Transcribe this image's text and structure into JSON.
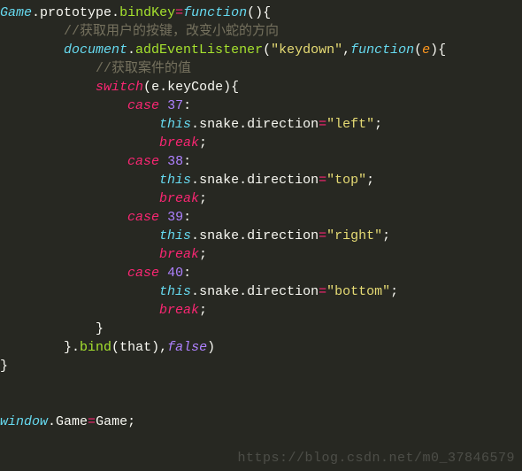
{
  "code": {
    "obj_game": "Game",
    "prototype": "prototype",
    "method": "bindKey",
    "fn_kw": "function",
    "comment1": "//获取用户的按键，改变小蛇的方向",
    "document": "document",
    "addEventListener": "addEventListener",
    "event_name": "\"keydown\"",
    "param_e": "e",
    "comment2": "//获取案件的值",
    "switch_kw": "switch",
    "keyCode": "keyCode",
    "case_kw": "case",
    "break_kw": "break",
    "this_kw": "this",
    "snake": "snake",
    "direction": "direction",
    "cases": [
      {
        "n": "37",
        "v": "\"left\""
      },
      {
        "n": "38",
        "v": "\"top\""
      },
      {
        "n": "39",
        "v": "\"right\""
      },
      {
        "n": "40",
        "v": "\"bottom\""
      }
    ],
    "bind": "bind",
    "that": "that",
    "false_kw": "false",
    "window": "window",
    "assign_game": "Game"
  },
  "watermark": "https://blog.csdn.net/m0_37846579"
}
